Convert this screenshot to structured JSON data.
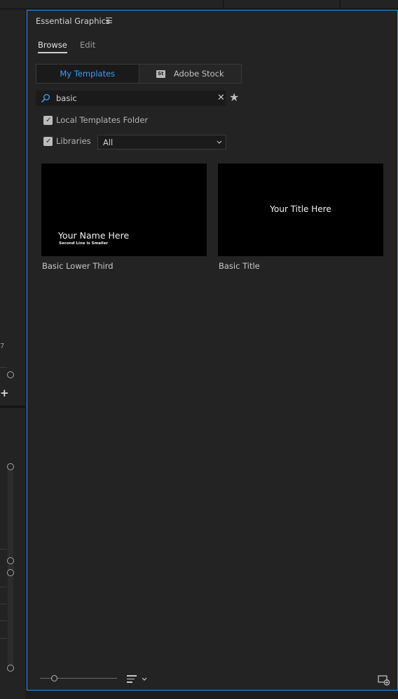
{
  "panel": {
    "title": "Essential Graphics",
    "tabs": {
      "browse": "Browse",
      "edit": "Edit"
    },
    "source": {
      "my_templates": "My Templates",
      "adobe_stock": "Adobe Stock",
      "stock_badge": "St"
    },
    "search": {
      "value": "basic"
    },
    "filters": {
      "local_label": "Local Templates Folder",
      "libraries_label": "Libraries",
      "libraries_value": "All"
    },
    "templates": [
      {
        "name": "Basic Lower Third",
        "preview_main": "Your Name Here",
        "preview_sub": "Second Line is Smaller"
      },
      {
        "name": "Basic Title",
        "preview_main": "Your Title Here"
      }
    ]
  },
  "left_panel": {
    "number_fragment": "7"
  },
  "colors": {
    "accent": "#3e9bf2",
    "panel_border": "#2d8ceb",
    "background": "#232323"
  },
  "icons": [
    "hamburger-icon",
    "search-icon",
    "clear-icon",
    "star-icon",
    "check-icon",
    "chevron-down-icon",
    "list-view-icon",
    "new-item-icon",
    "add-icon"
  ]
}
